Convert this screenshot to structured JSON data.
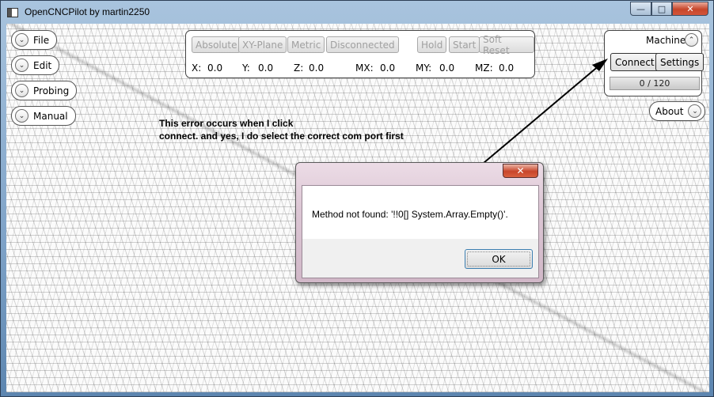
{
  "window": {
    "title": "OpenCNCPilot by martin2250",
    "caption": {
      "minimize": "—",
      "maximize": "□",
      "close": "✕"
    }
  },
  "menu": {
    "items": [
      {
        "label": "File"
      },
      {
        "label": "Edit"
      },
      {
        "label": "Probing"
      },
      {
        "label": "Manual"
      }
    ]
  },
  "status": {
    "buttons": [
      "Absolute",
      "XY-Plane",
      "Metric",
      "Disconnected",
      "Hold",
      "Start",
      "Soft Reset"
    ],
    "coords": [
      {
        "label": "X:",
        "value": "0.0"
      },
      {
        "label": "Y:",
        "value": "0.0"
      },
      {
        "label": "Z:",
        "value": "0.0"
      },
      {
        "label": "MX:",
        "value": "0.0"
      },
      {
        "label": "MY:",
        "value": "0.0"
      },
      {
        "label": "MZ:",
        "value": "0.0"
      }
    ]
  },
  "machine": {
    "label": "Machine",
    "connect": "Connect",
    "settings": "Settings",
    "progress": "0 / 120"
  },
  "about": {
    "label": "About"
  },
  "annotation": {
    "line1": "This error occurs when I click",
    "line2": "connect. and yes, I do select the correct com port first"
  },
  "dialog": {
    "close": "✕",
    "message": "Method not found: '!!0[] System.Array.Empty()'.",
    "ok": "OK"
  },
  "icons": {
    "chevron_down": "⌄",
    "chevron_up": "⌃"
  }
}
